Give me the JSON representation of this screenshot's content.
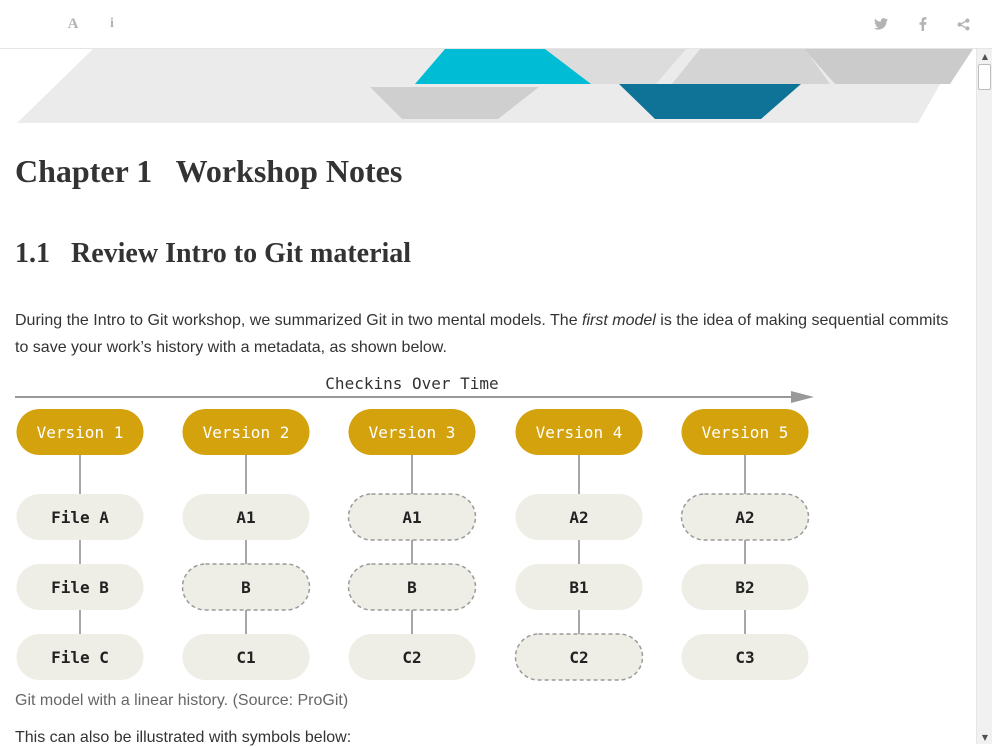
{
  "toolbar": {
    "left_buttons": [
      {
        "name": "font-settings-icon",
        "glyph": "A"
      },
      {
        "name": "info-icon",
        "glyph": "i"
      }
    ],
    "right_buttons": [
      {
        "name": "twitter-icon"
      },
      {
        "name": "facebook-icon"
      },
      {
        "name": "share-icon"
      }
    ]
  },
  "chapter": {
    "title": "Chapter 1   Workshop Notes"
  },
  "section": {
    "title": "1.1   Review Intro to Git material"
  },
  "paragraph": {
    "before_em": "During the Intro to Git workshop, we summarized Git in two mental models. The ",
    "em": "first model",
    "after_em": " is the idea of making sequential commits to save your work’s history with a metadata, as shown below."
  },
  "figure": {
    "header": "Checkins Over Time",
    "versions": [
      {
        "label": "Version 1",
        "files": [
          {
            "label": "File A",
            "dashed": false
          },
          {
            "label": "File B",
            "dashed": false
          },
          {
            "label": "File C",
            "dashed": false
          }
        ]
      },
      {
        "label": "Version 2",
        "files": [
          {
            "label": "A1",
            "dashed": false
          },
          {
            "label": "B",
            "dashed": true
          },
          {
            "label": "C1",
            "dashed": false
          }
        ]
      },
      {
        "label": "Version 3",
        "files": [
          {
            "label": "A1",
            "dashed": true
          },
          {
            "label": "B",
            "dashed": true
          },
          {
            "label": "C2",
            "dashed": false
          }
        ]
      },
      {
        "label": "Version 4",
        "files": [
          {
            "label": "A2",
            "dashed": false
          },
          {
            "label": "B1",
            "dashed": false
          },
          {
            "label": "C2",
            "dashed": true
          }
        ]
      },
      {
        "label": "Version 5",
        "files": [
          {
            "label": "A2",
            "dashed": true
          },
          {
            "label": "B2",
            "dashed": false
          },
          {
            "label": "C3",
            "dashed": false
          }
        ]
      }
    ],
    "caption": "Git model with a linear history. (Source: ProGit)"
  },
  "next_paragraph": "This can also be illustrated with symbols below:",
  "colors": {
    "version_fill": "#d4a20c",
    "file_fill": "#eeede6",
    "banner_teal": "#00bcd4",
    "banner_dark_teal": "#0e7397",
    "banner_gray": "#d4d4d4",
    "banner_light": "#ebebeb"
  }
}
